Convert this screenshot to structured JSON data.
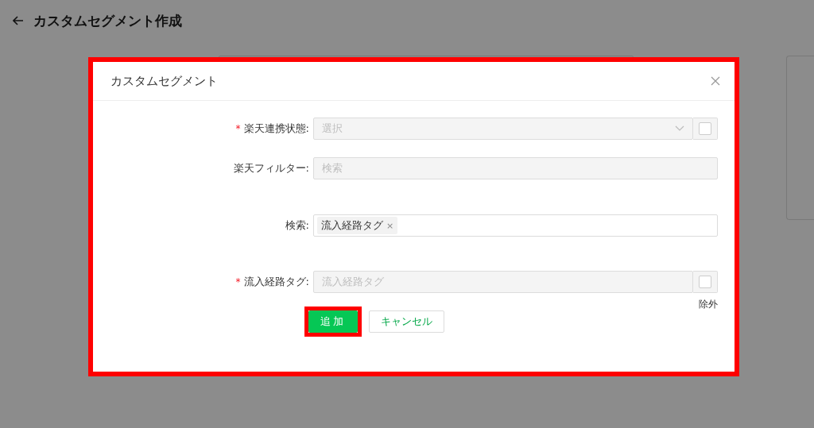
{
  "page": {
    "title": "カスタムセグメント作成"
  },
  "dialog": {
    "title": "カスタムセグメント",
    "fields": [
      {
        "kind": "select",
        "label": "楽天連携状態:",
        "required_mark": "*",
        "placeholder": "選択",
        "checkbox": {
          "checked": false
        }
      },
      {
        "kind": "input",
        "label": "楽天フィルター:",
        "placeholder": "検索"
      },
      {
        "kind": "tags",
        "label": "検索:",
        "tags": [
          {
            "text": "流入経路タグ",
            "remove": "×"
          }
        ]
      },
      {
        "kind": "input",
        "label": "流入経路タグ:",
        "required_mark": "*",
        "placeholder": "流入経路タグ",
        "checkbox": {
          "checked": false,
          "label": "除外"
        }
      }
    ],
    "buttons": [
      {
        "label": "追加",
        "kind": "primary",
        "highlighted": true
      },
      {
        "label": "キャンセル",
        "kind": "secondary",
        "highlighted": false
      }
    ]
  }
}
